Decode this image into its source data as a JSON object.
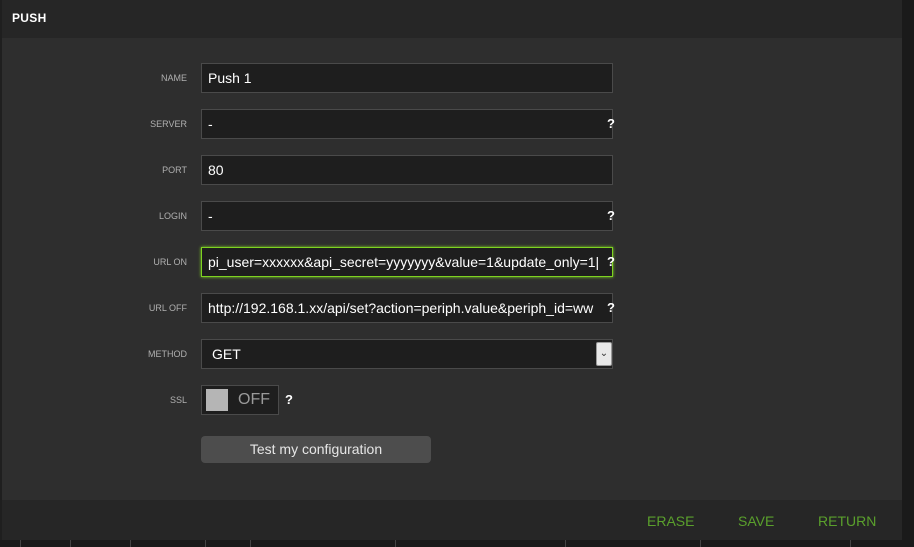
{
  "dialog": {
    "title": "PUSH"
  },
  "form": {
    "name": {
      "label": "NAME",
      "value": "Push 1"
    },
    "server": {
      "label": "SERVER",
      "value": "-",
      "help": "?"
    },
    "port": {
      "label": "PORT",
      "value": "80"
    },
    "login": {
      "label": "LOGIN",
      "value": "-",
      "help": "?"
    },
    "url_on": {
      "label": "URL ON",
      "value": "pi_user=xxxxxx&api_secret=yyyyyyy&value=1&update_only=1|",
      "help": "?"
    },
    "url_off": {
      "label": "URL OFF",
      "value": "http://192.168.1.xx/api/set?action=periph.value&periph_id=ww",
      "help": "?"
    },
    "method": {
      "label": "METHOD",
      "value": "GET"
    },
    "ssl": {
      "label": "SSL",
      "state": "OFF",
      "help": "?"
    },
    "test_button": "Test my configuration"
  },
  "footer": {
    "erase": "ERASE",
    "save": "SAVE",
    "return": "RETURN"
  },
  "colors": {
    "accent_green": "#5aa02c",
    "focus_border": "#7ed321",
    "background": "#2e2e2e"
  },
  "icons": {
    "select_arrow": "chevron-down-icon"
  }
}
